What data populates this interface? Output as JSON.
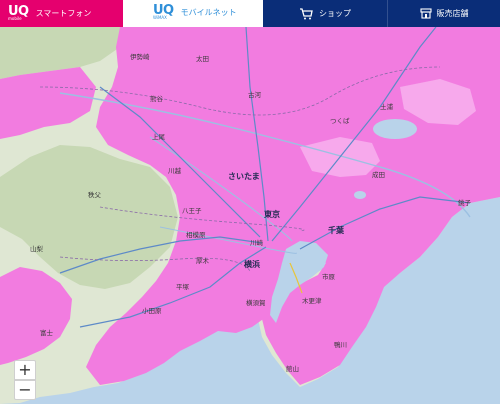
{
  "nav": {
    "mobile_logo": "UQ",
    "mobile_logo_sub": "mobile",
    "mobile_label": "スマートフォン",
    "wimax_logo": "UQ",
    "wimax_logo_sub": "WiMAX",
    "wimax_label": "モバイルネット",
    "shop_label": "ショップ",
    "store_label": "販売店舗",
    "active_tab": "wimax"
  },
  "colors": {
    "coverage": "#f27ce0",
    "coverage_light": "#f7a9ec",
    "terrain": "#dfe7d3",
    "forest": "#c7d8b4",
    "sea": "#b9d3ea",
    "brand_mobile": "#e5006e",
    "brand_wimax": "#2f8fd8",
    "nav_dark": "#0a2d78"
  },
  "map": {
    "labels": [
      "伊勢崎",
      "太田",
      "上尾",
      "熊谷",
      "古河",
      "つくば",
      "土浦",
      "さいたま",
      "川越",
      "東京",
      "千葉",
      "八王子",
      "川崎",
      "横浜",
      "相模原",
      "成田",
      "銚子",
      "木更津",
      "鴨川",
      "館山",
      "横須賀",
      "厚木",
      "平塚",
      "小田原",
      "秩父",
      "山梨",
      "富士",
      "市原"
    ],
    "zoom_in": "+",
    "zoom_out": "−"
  }
}
